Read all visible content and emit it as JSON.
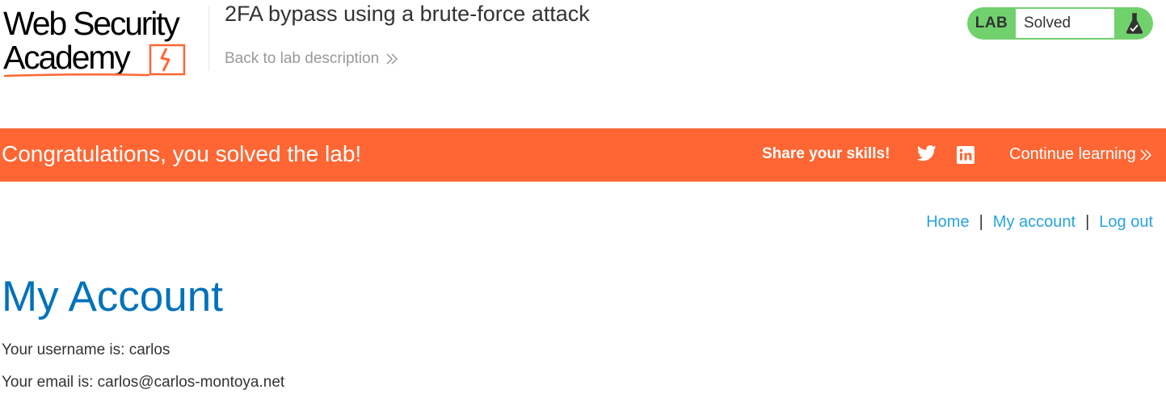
{
  "header": {
    "logo_line1": "Web Security",
    "logo_line2": "Academy",
    "lab_title": "2FA bypass using a brute-force attack",
    "back_link": "Back to lab description"
  },
  "lab_status": {
    "label": "LAB",
    "status": "Solved",
    "colors": {
      "badge": "#70d16d"
    }
  },
  "banner": {
    "title": "Congratulations, you solved the lab!",
    "share_label": "Share your skills!",
    "continue_link": "Continue learning",
    "colors": {
      "background": "#ff6633"
    }
  },
  "nav": {
    "home": "Home",
    "separator": "|",
    "my_account": "My account",
    "log_out": "Log out"
  },
  "account": {
    "heading": "My Account",
    "username_line": "Your username is: carlos",
    "email_line": "Your email is: carlos@carlos-montoya.net"
  },
  "icons": {
    "back": "double-chevron-right-icon",
    "flask": "flask-icon",
    "twitter": "twitter-icon",
    "linkedin": "linkedin-icon",
    "continue": "double-chevron-right-icon"
  }
}
